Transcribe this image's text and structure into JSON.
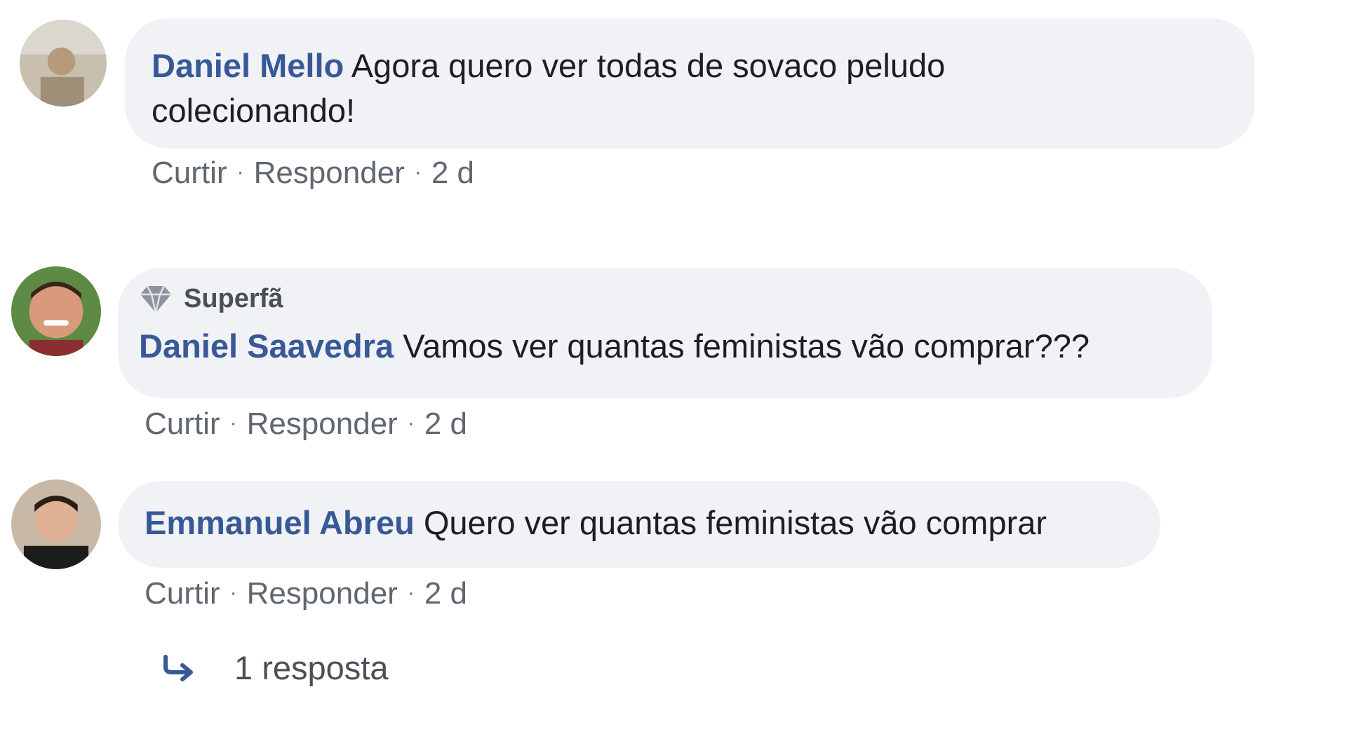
{
  "comments": [
    {
      "author": "Daniel Mello",
      "text_line1": "Agora quero ver todas de sovaco peludo",
      "text_line2": "colecionando!",
      "like": "Curtir",
      "reply": "Responder",
      "time": "2 d"
    },
    {
      "badge": "Superfã",
      "author": "Daniel Saavedra",
      "text": "Vamos ver quantas feministas vão comprar???",
      "like": "Curtir",
      "reply": "Responder",
      "time": "2 d"
    },
    {
      "author": "Emmanuel Abreu",
      "text": "Quero ver quantas feministas vão comprar",
      "like": "Curtir",
      "reply": "Responder",
      "time": "2 d"
    }
  ],
  "replies": {
    "label": "1 resposta",
    "icon": "reply-arrow-icon"
  },
  "colors": {
    "author": "#385898",
    "bubble": "#f0f2f5",
    "meta": "#606770"
  }
}
